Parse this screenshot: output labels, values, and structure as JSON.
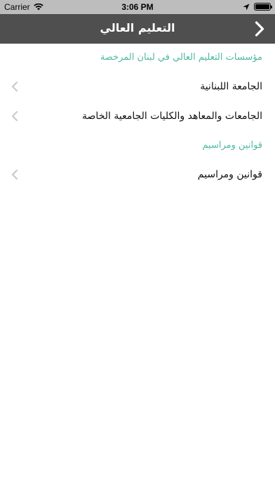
{
  "status_bar": {
    "carrier": "Carrier",
    "time": "3:06 PM"
  },
  "nav": {
    "title": "التعليم العالي",
    "back_icon": "chevron-right-icon"
  },
  "sections": [
    {
      "header": "مؤسسات التعليم العالي في لبنان المرخصة",
      "items": [
        {
          "label": "الجامعة اللبنانية"
        },
        {
          "label": "الجامعات والمعاهد والكليات الجامعية الخاصة"
        }
      ]
    },
    {
      "header": "قوانين ومراسيم",
      "items": [
        {
          "label": "قوانين ومراسيم"
        }
      ]
    }
  ],
  "colors": {
    "nav_background": "#4f4f4f",
    "section_header": "#4fb8a4",
    "chevron": "#c7c7cc"
  }
}
